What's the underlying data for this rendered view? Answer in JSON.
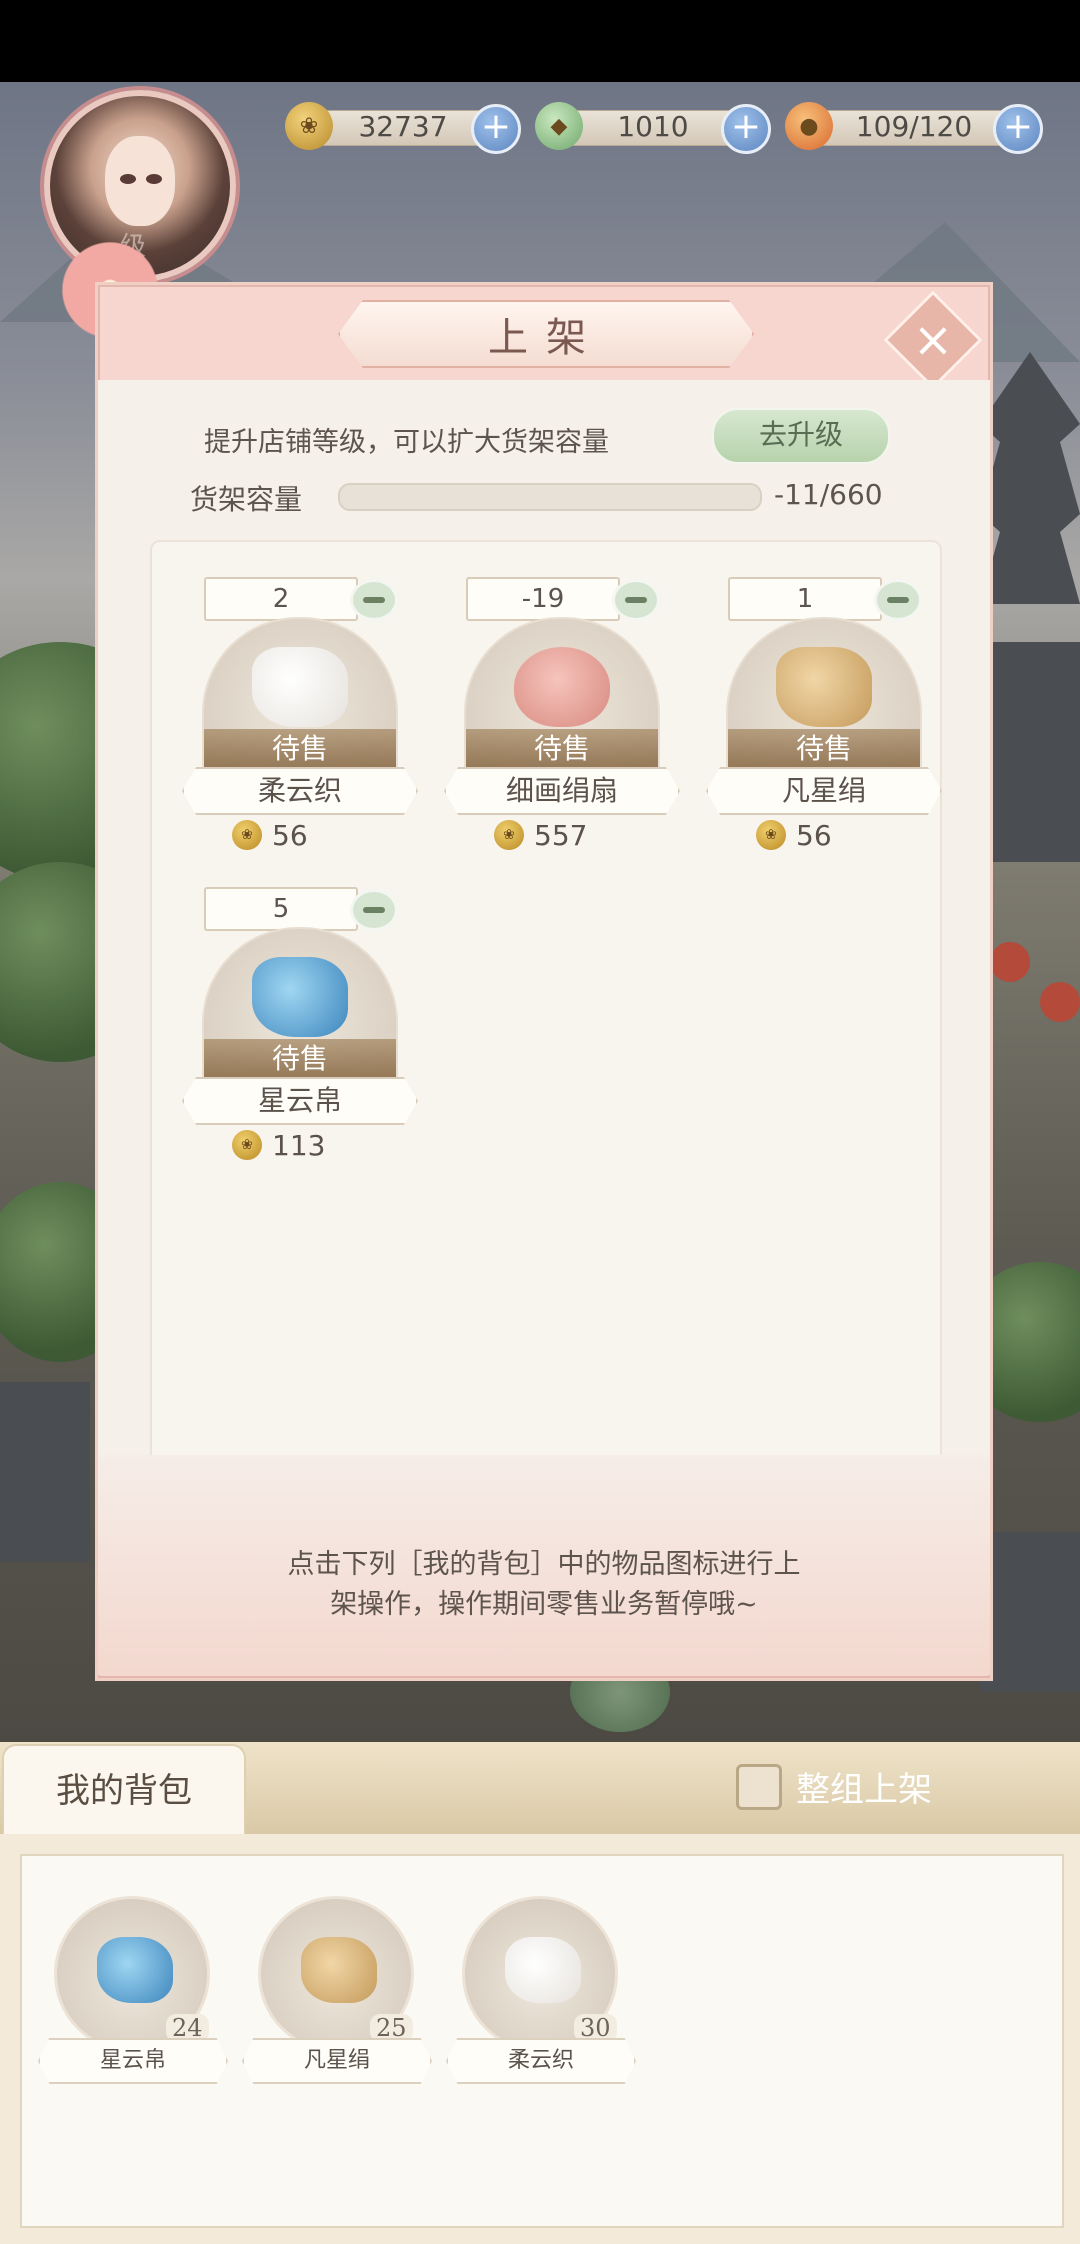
{
  "currency": [
    {
      "name": "coins",
      "value": "32737",
      "icon": "paw-coin-icon",
      "color": "#d6a545"
    },
    {
      "name": "jade",
      "value": "1010",
      "icon": "jade-frog-icon",
      "color": "#8fc28a"
    },
    {
      "name": "stamina",
      "value": "109/120",
      "icon": "peach-bun-icon",
      "color": "#e6883f"
    }
  ],
  "avatar": {
    "level_text": "级"
  },
  "dialog": {
    "title": "上架",
    "upgrade_hint": "提升店铺等级，可以扩大货架容量",
    "upgrade_button": "去升级",
    "capacity_label": "货架容量",
    "capacity_value": "-11/660",
    "capacity_fill": 0,
    "items": [
      {
        "qty": "2",
        "name": "柔云织",
        "status": "待售",
        "price": "56",
        "color": "#ffffff"
      },
      {
        "qty": "-19",
        "name": "细画绢扇",
        "status": "待售",
        "price": "557",
        "color": "#e8a39a"
      },
      {
        "qty": "1",
        "name": "凡星绢",
        "status": "待售",
        "price": "56",
        "color": "#d8b27a"
      },
      {
        "qty": "5",
        "name": "星云帛",
        "status": "待售",
        "price": "113",
        "color": "#5aa4d2"
      }
    ],
    "footer_text_1": "点击下列［我的背包］中的物品图标进行上",
    "footer_text_2": "架操作，操作期间零售业务暂停哦~"
  },
  "bag": {
    "tab_label": "我的背包",
    "group_label": "整组上架",
    "items": [
      {
        "name": "星云帛",
        "count": "24",
        "color": "#5aa4d2"
      },
      {
        "name": "凡星绢",
        "count": "25",
        "color": "#d8b27a"
      },
      {
        "name": "柔云织",
        "count": "30",
        "color": "#ffffff"
      }
    ]
  }
}
